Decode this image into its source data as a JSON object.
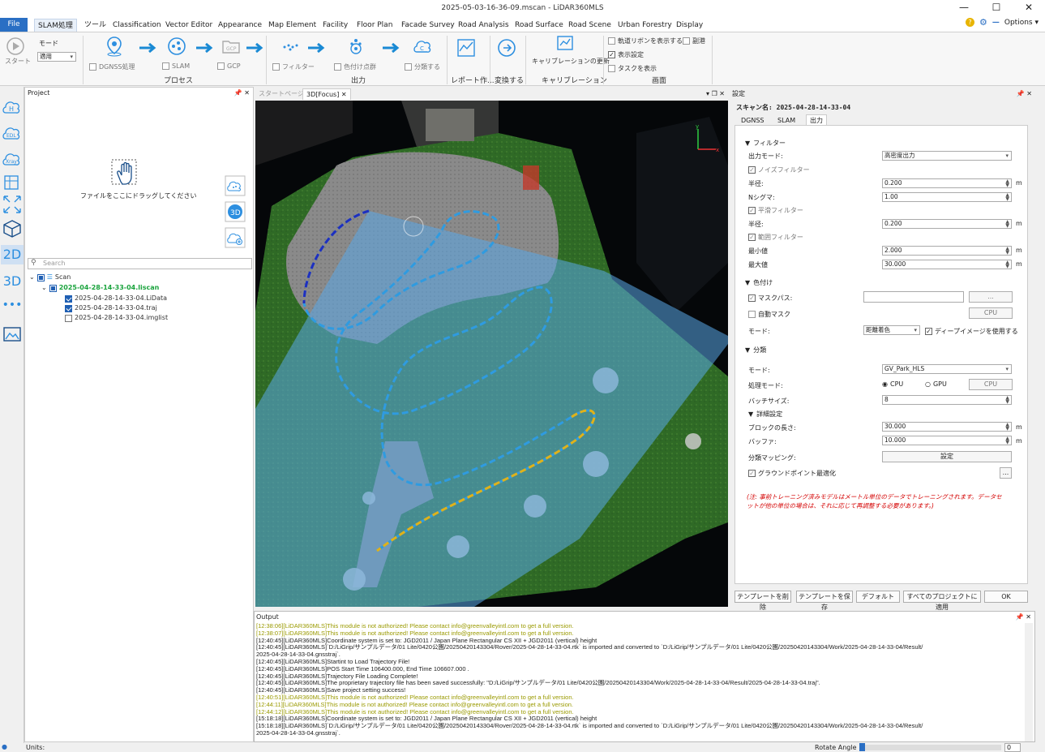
{
  "window": {
    "title": "2025-05-03-16-36-09.mscan - LiDAR360MLS"
  },
  "menu": {
    "file": "File",
    "items": [
      "SLAM処理",
      "ツール",
      "Classification",
      "Vector Editor",
      "Appearance",
      "Map Element",
      "Facility",
      "Floor Plan",
      "Facade Survey",
      "Road Analysis",
      "Road Surface",
      "Road Scene",
      "Urban Forestry",
      "Display"
    ],
    "options": "Options"
  },
  "ribbon": {
    "start": "スタート",
    "mode_label": "モード",
    "mode_value": "適用",
    "dgnss": "DGNSS処理",
    "slam": "SLAM",
    "gcp": "GCP",
    "process_group": "プロセス",
    "filter": "フィルター",
    "colorize": "色付け点群",
    "classify": "分類する",
    "output_group": "出力",
    "report": "レポート作...",
    "convert": "変換する",
    "calib_update": "キャリブレーションの更新",
    "calib_group": "キャリブレーション",
    "show_traj": "軌道リボンを表示する",
    "grid": "副港",
    "display_settings": "表示設定",
    "show_task": "タスクを表示",
    "screen_group": "画面"
  },
  "project": {
    "title": "Project",
    "drop_hint": "ファイルをここにドラッグしてください",
    "search_placeholder": "Search",
    "scan": "Scan",
    "liscan": "2025-04-28-14-33-04.liscan",
    "lidata": "2025-04-28-14-33-04.LiData",
    "traj": "2025-04-28-14-33-04.traj",
    "imglist": "2025-04-28-14-33-04.imglist"
  },
  "left_labels": {
    "twod": "2D",
    "threed": "3D"
  },
  "viewtabs": {
    "start": "スタートページ",
    "focus": "3D[Focus]"
  },
  "settings": {
    "title": "設定",
    "scan_name": "スキャン名: 2025-04-28-14-33-04",
    "tabs": [
      "DGNSS",
      "SLAM",
      "出力"
    ],
    "filter_section": "フィルター",
    "output_mode_label": "出力モード:",
    "output_mode_value": "高密度出力",
    "noise_filter": "ノイズフィルター",
    "radius_label": "半径:",
    "radius_value": "0.200",
    "nsigma_label": "Nシグマ:",
    "nsigma_value": "1.00",
    "smooth_filter": "平滑フィルター",
    "radius2_label": "半径:",
    "radius2_value": "0.200",
    "range_filter": "範囲フィルター",
    "min_label": "最小値",
    "min_value": "2.000",
    "max_label": "最大値",
    "max_value": "30.000",
    "unit_m": "m",
    "color_section": "色付け",
    "mask_path": "マスクパス:",
    "browse": "...",
    "auto_mask": "自動マスク",
    "cpu": "CPU",
    "mode_label": "モード:",
    "mode_value": "距離着色",
    "deep_image": "ディープイメージを使用する",
    "class_section": "分類",
    "class_mode_label": "モード:",
    "class_mode_value": "GV_Park_HLS",
    "proc_mode_label": "処理モード:",
    "cpu_radio": "CPU",
    "gpu_radio": "GPU",
    "batch_label": "バッチサイズ:",
    "batch_value": "8",
    "detail_section": "詳細設定",
    "block_label": "ブロックの長さ:",
    "block_value": "30.000",
    "buffer_label": "バッファ:",
    "buffer_value": "10.000",
    "class_map_label": "分類マッピング:",
    "class_map_btn": "設定",
    "ground_opt": "グラウンドポイント最適化",
    "note": "(注: 事前トレーニング済みモデルはメートル単位のデータでトレーニングされます。データセットが他の単位の場合は、それに応じて再調整する必要があります。)",
    "btn_delete_tpl": "テンプレートを削除",
    "btn_save_tpl": "テンプレートを保存",
    "btn_default": "デフォルト",
    "btn_apply_all": "すべてのプロジェクトに適用",
    "btn_ok": "OK"
  },
  "output": {
    "title": "Output",
    "lines": [
      {
        "t": "w",
        "s": "[12:38:06][LiDAR360MLS]This module is not authorized! Please contact info@greenvalleyintl.com to get a full version."
      },
      {
        "t": "w",
        "s": "[12:38:07][LiDAR360MLS]This module is not authorized! Please contact info@greenvalleyintl.com to get a full version."
      },
      {
        "t": "n",
        "s": "[12:40:45][LiDAR360MLS]Coordinate system is set to: JGD2011 / Japan Plane Rectangular CS XII + JGD2011 (vertical) height"
      },
      {
        "t": "n",
        "s": "[12:40:45][LiDAR360MLS]`D:/LiGrip/サンプルデータ/01 Lite/0420公園/20250420143304/Rover/2025-04-28-14-33-04.rtk` is imported and converted to `D:/LiGrip/サンプルデータ/01 Lite/0420公園/20250420143304/Work/2025-04-28-14-33-04/Result/"
      },
      {
        "t": "n",
        "s": "2025-04-28-14-33-04.gnsstraj`."
      },
      {
        "t": "n",
        "s": "[12:40:45][LiDAR360MLS]Startint to Load Trajectory File!"
      },
      {
        "t": "n",
        "s": "[12:40:45][LiDAR360MLS]POS Start Time 106400.000, End Time 106607.000 ."
      },
      {
        "t": "n",
        "s": "[12:40:45][LiDAR360MLS]Trajectory File Loading Complete!"
      },
      {
        "t": "n",
        "s": "[12:40:45][LiDAR360MLS]The proprietary trajectory file has been saved successfully: \"D:/LiGrip/サンプルデータ/01 Lite/0420公園/20250420143304/Work/2025-04-28-14-33-04/Result/2025-04-28-14-33-04.traj\"."
      },
      {
        "t": "n",
        "s": "[12:40:45][LiDAR360MLS]Save project setting success!"
      },
      {
        "t": "w",
        "s": "[12:40:51][LiDAR360MLS]This module is not authorized! Please contact info@greenvalleyintl.com to get a full version."
      },
      {
        "t": "w",
        "s": "[12:44:11][LiDAR360MLS]This module is not authorized! Please contact info@greenvalleyintl.com to get a full version."
      },
      {
        "t": "w",
        "s": "[12:44:12][LiDAR360MLS]This module is not authorized! Please contact info@greenvalleyintl.com to get a full version."
      },
      {
        "t": "n",
        "s": "[15:18:18][LiDAR360MLS]Coordinate system is set to: JGD2011 / Japan Plane Rectangular CS XII + JGD2011 (vertical) height"
      },
      {
        "t": "n",
        "s": "[15:18:18][LiDAR360MLS]`D:/LiGrip/サンプルデータ/01 Lite/0420公園/20250420143304/Rover/2025-04-28-14-33-04.rtk` is imported and converted to `D:/LiGrip/サンプルデータ/01 Lite/0420公園/20250420143304/Work/2025-04-28-14-33-04/Result/"
      },
      {
        "t": "n",
        "s": "2025-04-28-14-33-04.gnsstraj`."
      }
    ]
  },
  "status": {
    "units": "Units:",
    "rotate_label": "Rotate Angle",
    "rotate_value": "0"
  },
  "colors": {
    "file_menu": "#2a6fc4",
    "accent": "#1f8fe0",
    "note": "#d40000",
    "warn_log": "#9a9a00"
  }
}
